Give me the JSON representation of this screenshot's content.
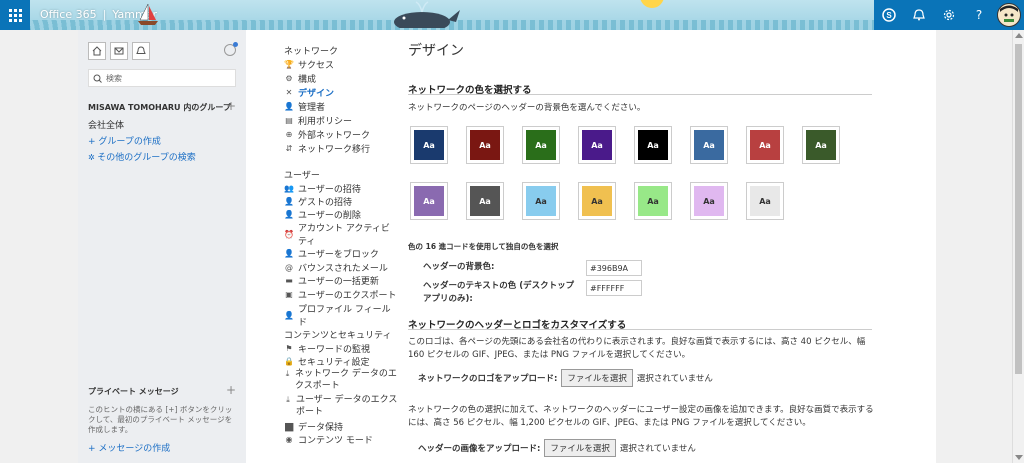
{
  "topbar": {
    "app_name": "Office 365",
    "separator": "|",
    "product": "Yammer",
    "icons": [
      "app-launcher-icon",
      "skype-icon",
      "bell-icon",
      "gear-icon",
      "help-icon",
      "avatar"
    ],
    "help_glyph": "?"
  },
  "left": {
    "search_placeholder": "検索",
    "group_header": "MISAWA TOMOHARU 内のグループ",
    "items": {
      "all_company": "会社全体",
      "create_group": "+ グループの作成",
      "find_groups": "その他のグループの検索"
    },
    "private_header": "プライベート メッセージ",
    "private_hint": "このヒントの横にある [+] ボタンをクリックして、最初のプライベート メッセージを作成します。",
    "compose": "+ メッセージの作成"
  },
  "nav": {
    "network_heading": "ネットワーク",
    "network_items": [
      "サクセス",
      "構成",
      "デザイン",
      "管理者",
      "利用ポリシー",
      "外部ネットワーク",
      "ネットワーク移行"
    ],
    "users_heading": "ユーザー",
    "users_items": [
      "ユーザーの招待",
      "ゲストの招待",
      "ユーザーの削除",
      "アカウント アクティビティ",
      "ユーザーをブロック",
      "バウンスされたメール",
      "ユーザーの一括更新",
      "ユーザーのエクスポート",
      "プロファイル フィールド"
    ],
    "content_heading": "コンテンツとセキュリティ",
    "content_items": [
      "キーワードの監視",
      "セキュリティ設定",
      "ネットワーク データのエクスポート",
      "ユーザー データのエクスポート",
      "データ保持",
      "コンテンツ モード"
    ]
  },
  "main": {
    "title": "デザイン",
    "color_section_title": "ネットワークの色を選択する",
    "color_section_desc": "ネットワークのページのヘッダーの背景色を選んでください。",
    "swatch_label": "Aa",
    "swatches": [
      "#1a3a6e",
      "#7a1712",
      "#2a6e1a",
      "#4a1a8a",
      "#000000",
      "#3a6aa0",
      "#b84040",
      "#3a5a2a",
      "#8a6ab0",
      "#555555",
      "#88ccee",
      "#f0c050",
      "#98e888",
      "#e0b8f0",
      "#e8e8e8"
    ],
    "custom_heading": "色の 16 進コードを使用して独自の色を選択",
    "header_bg_label": "ヘッダーの背景色:",
    "header_bg_value": "#396B9A",
    "header_text_label": "ヘッダーのテキストの色 (デスクトップ アプリのみ):",
    "header_text_value": "#FFFFFF",
    "logo_section_title": "ネットワークのヘッダーとロゴをカスタマイズする",
    "logo_desc": "このロゴは、各ページの先頭にある会社名の代わりに表示されます。良好な画質で表示するには、高さ 40 ピクセル、幅 160 ピクセルの GIF、JPEG、または PNG ファイルを選択してください。",
    "logo_upload_label": "ネットワークのロゴをアップロード:",
    "file_button": "ファイルを選択",
    "no_file": "選択されていません",
    "header_desc": "ネットワークの色の選択に加えて、ネットワークのヘッダーにユーザー設定の画像を追加できます。良好な画質で表示するには、高さ 56 ピクセル、幅 1,200 ピクセルの GIF、JPEG、または PNG ファイルを選択してください。",
    "header_upload_label": "ヘッダーの画像をアップロード:"
  }
}
